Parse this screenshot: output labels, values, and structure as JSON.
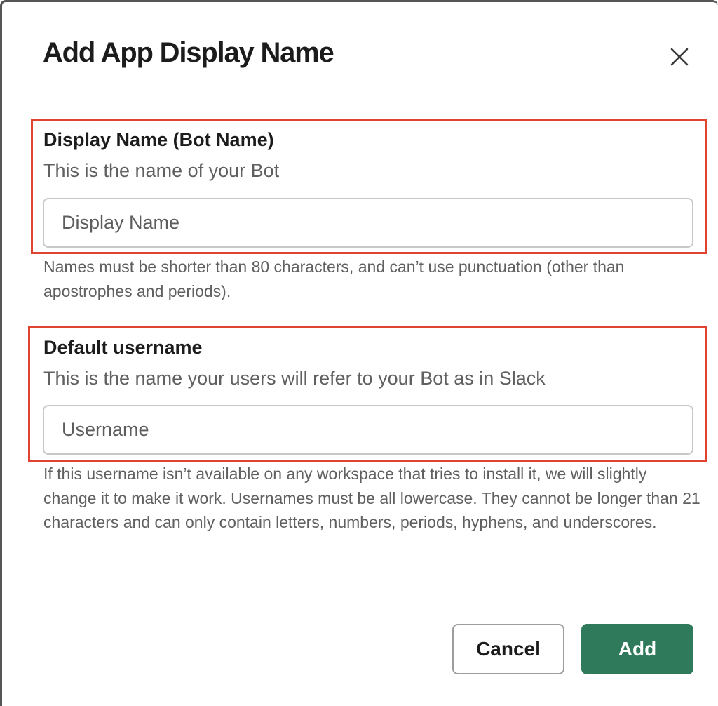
{
  "dialog": {
    "title": "Add App Display Name",
    "close_icon": "close-icon"
  },
  "display_name": {
    "label": "Display Name (Bot Name)",
    "description": "This is the name of your Bot",
    "placeholder": "Display Name",
    "value": "",
    "help": "Names must be shorter than 80 characters, and can’t use punctuation (other than apostrophes and periods)."
  },
  "username": {
    "label": "Default username",
    "description": "This is the name your users will refer to your Bot as in Slack",
    "placeholder": "Username",
    "value": "",
    "help": "If this username isn’t available on any workspace that tries to install it, we will slightly change it to make it work. Usernames must be all lowercase. They cannot be longer than 21 characters and can only contain letters, numbers, periods, hyphens, and underscores."
  },
  "buttons": {
    "cancel_label": "Cancel",
    "add_label": "Add"
  },
  "colors": {
    "primary": "#2f7a5a",
    "highlight": "#e0432f"
  }
}
